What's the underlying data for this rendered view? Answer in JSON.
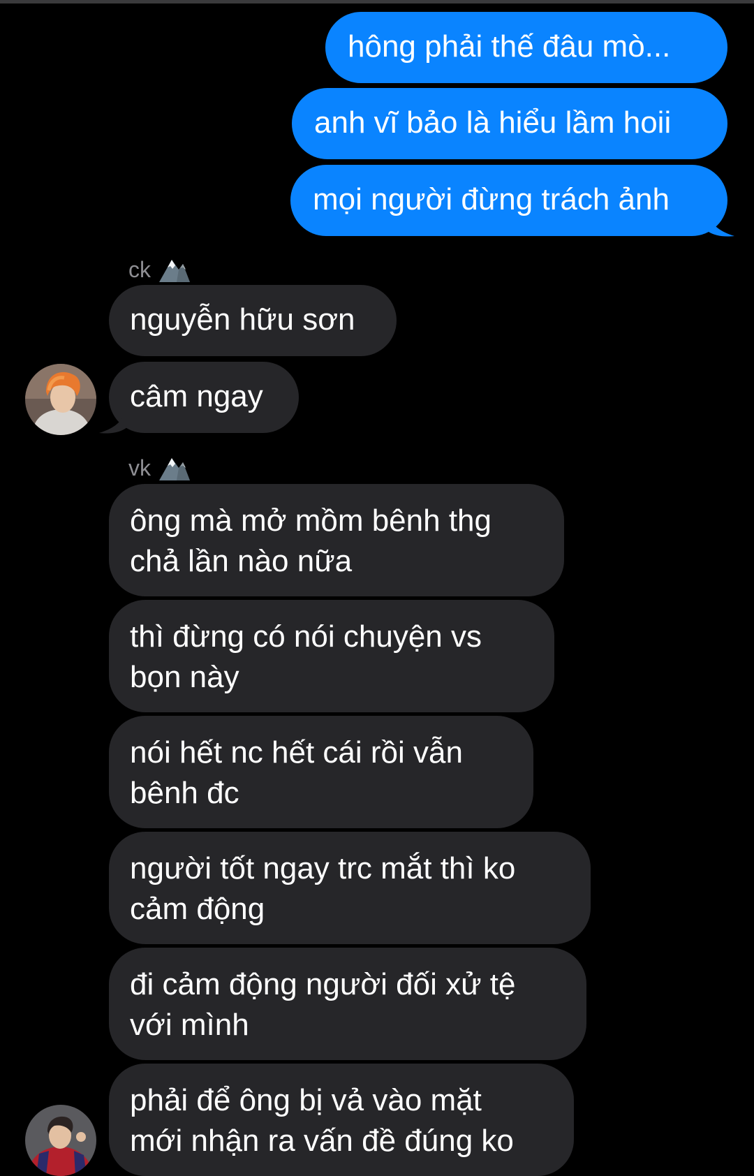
{
  "conversation": {
    "outgoing": [
      "hông phải thế đâu mò...",
      "anh vĩ bảo là hiểu lầm hoii",
      "mọi người đừng trách ảnh"
    ],
    "group_ck": {
      "sender": "ck",
      "sender_icon": "mountain-emoji",
      "messages": [
        "nguyễn hữu sơn",
        "câm ngay"
      ]
    },
    "group_vk": {
      "sender": "vk",
      "sender_icon": "mountain-emoji",
      "messages": [
        "ông mà mở mồm bênh thg\nchả lần nào nữa",
        "thì đừng có nói chuyện vs\nbọn này",
        "nói hết nc hết cái rồi vẫn\nbênh đc",
        "người tốt ngay trc mắt thì ko\ncảm động",
        "đi cảm động người đối xử tệ\nvới mình",
        "phải để ông bị vả vào mặt\nmới nhận ra vấn đề đúng ko"
      ]
    }
  },
  "colors": {
    "outgoing_bubble": "#0a84ff",
    "incoming_bubble": "#262629",
    "background": "#000000",
    "sender_label": "#8e8e93"
  }
}
